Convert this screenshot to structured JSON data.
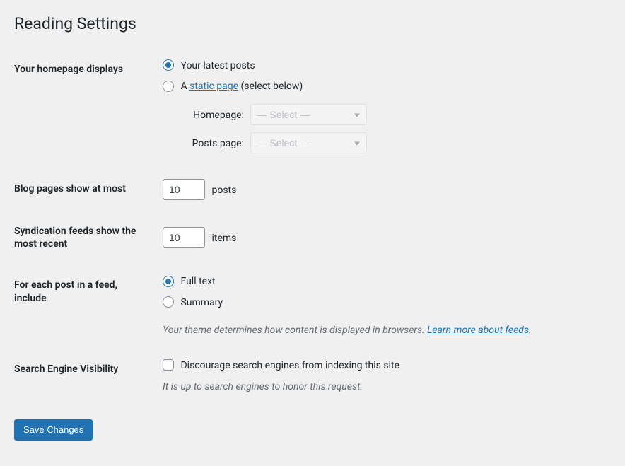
{
  "page_title": "Reading Settings",
  "homepage": {
    "th": "Your homepage displays",
    "option_latest": "Your latest posts",
    "option_static_prefix": "A ",
    "option_static_link": "static page",
    "option_static_suffix": " (select below)",
    "homepage_label": "Homepage:",
    "posts_page_label": "Posts page:",
    "select_placeholder": "— Select —"
  },
  "blog_pages": {
    "th": "Blog pages show at most",
    "value": "10",
    "suffix": "posts"
  },
  "syndication": {
    "th": "Syndication feeds show the most recent",
    "value": "10",
    "suffix": "items"
  },
  "feed_content": {
    "th": "For each post in a feed, include",
    "option_full": "Full text",
    "option_summary": "Summary",
    "desc_prefix": "Your theme determines how content is displayed in browsers. ",
    "desc_link": "Learn more about feeds",
    "desc_suffix": "."
  },
  "search_visibility": {
    "th": "Search Engine Visibility",
    "checkbox_label": "Discourage search engines from indexing this site",
    "desc": "It is up to search engines to honor this request."
  },
  "submit": "Save Changes"
}
